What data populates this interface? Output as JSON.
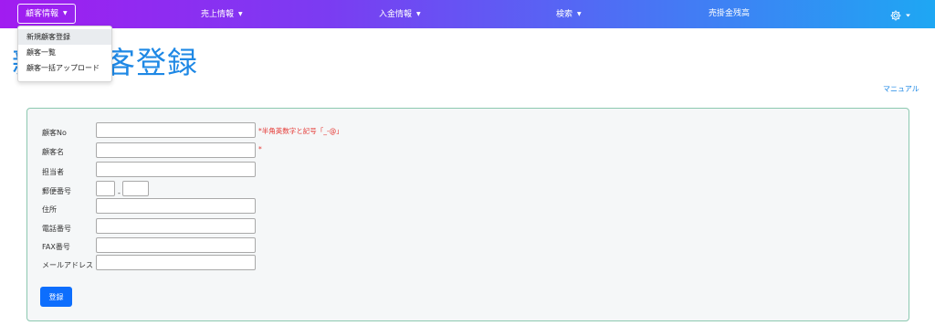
{
  "nav": {
    "items": [
      {
        "label": "顧客情報"
      },
      {
        "label": "売上情報"
      },
      {
        "label": "入金情報"
      },
      {
        "label": "検索"
      },
      {
        "label": "売掛金残高"
      }
    ],
    "caret": "▼"
  },
  "dropdown": {
    "items": [
      {
        "label": "新規顧客登録"
      },
      {
        "label": "顧客一覧"
      },
      {
        "label": "顧客一括アップロード"
      }
    ]
  },
  "page": {
    "title": "新規顧客登録",
    "manual_link": "マニュアル"
  },
  "form": {
    "customer_no": {
      "label": "顧客No",
      "value": "",
      "note": "*半角英数字と記号「_-@」"
    },
    "customer_name": {
      "label": "顧客名",
      "value": "",
      "note": "*"
    },
    "person_in_charge": {
      "label": "担当者",
      "value": ""
    },
    "postal_code": {
      "label": "郵便番号",
      "value1": "",
      "separator": "-",
      "value2": ""
    },
    "address": {
      "label": "住所",
      "value": ""
    },
    "phone": {
      "label": "電話番号",
      "value": ""
    },
    "fax": {
      "label": "FAX番号",
      "value": ""
    },
    "email": {
      "label": "メールアドレス",
      "value": ""
    },
    "submit_label": "登録"
  },
  "colors": {
    "nav_gradient_start": "#a11cf0",
    "nav_gradient_end": "#1ea7f3",
    "title_blue": "#1e88e5",
    "required_red": "#e53935",
    "button_blue": "#0d6efd",
    "card_border": "#8cc8b0"
  },
  "icons": {
    "settings": "gear-icon",
    "dropdown_arrow": "caret-down-icon"
  }
}
